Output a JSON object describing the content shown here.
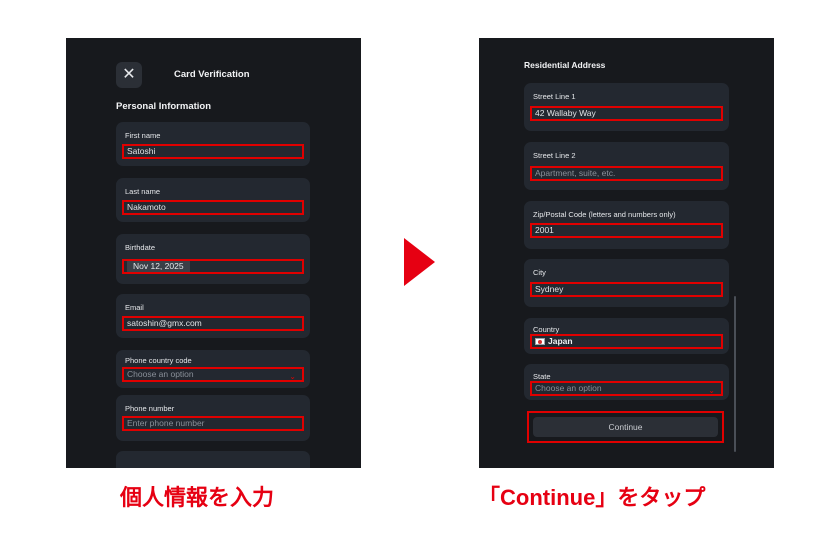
{
  "left_screen": {
    "title": "Card Verification",
    "close_icon": "✕",
    "section_title": "Personal Information",
    "fields": {
      "first_name": {
        "label": "First name",
        "value": "Satoshi"
      },
      "last_name": {
        "label": "Last name",
        "value": "Nakamoto"
      },
      "birthdate": {
        "label": "Birthdate",
        "value": "Nov 12, 2025"
      },
      "email": {
        "label": "Email",
        "value": "satoshin@gmx.com"
      },
      "phone_country_code": {
        "label": "Phone country code",
        "placeholder": "Choose an option"
      },
      "phone_number": {
        "label": "Phone number",
        "placeholder": "Enter phone number"
      }
    }
  },
  "right_screen": {
    "section_title": "Residential Address",
    "fields": {
      "street_line_1": {
        "label": "Street Line 1",
        "value": "42 Wallaby Way"
      },
      "street_line_2": {
        "label": "Street Line 2",
        "placeholder": "Apartment, suite, etc."
      },
      "zip": {
        "label": "Zip/Postal Code (letters and numbers only)",
        "value": "2001"
      },
      "city": {
        "label": "City",
        "value": "Sydney"
      },
      "country": {
        "label": "Country",
        "value": "Japan"
      },
      "state": {
        "label": "State",
        "placeholder": "Choose an option"
      }
    },
    "continue_label": "Continue"
  },
  "captions": {
    "left": "個人情報を入力",
    "right": "「Continue」をタップ"
  },
  "colors": {
    "highlight": "#e00000",
    "caption": "#e60012",
    "screen_bg": "#17191d",
    "field_bg": "#232830"
  },
  "icons": {
    "close": "close-icon",
    "dropdown": "chevron-down-icon",
    "flag": "japan-flag-icon",
    "step": "right-arrow-icon"
  }
}
